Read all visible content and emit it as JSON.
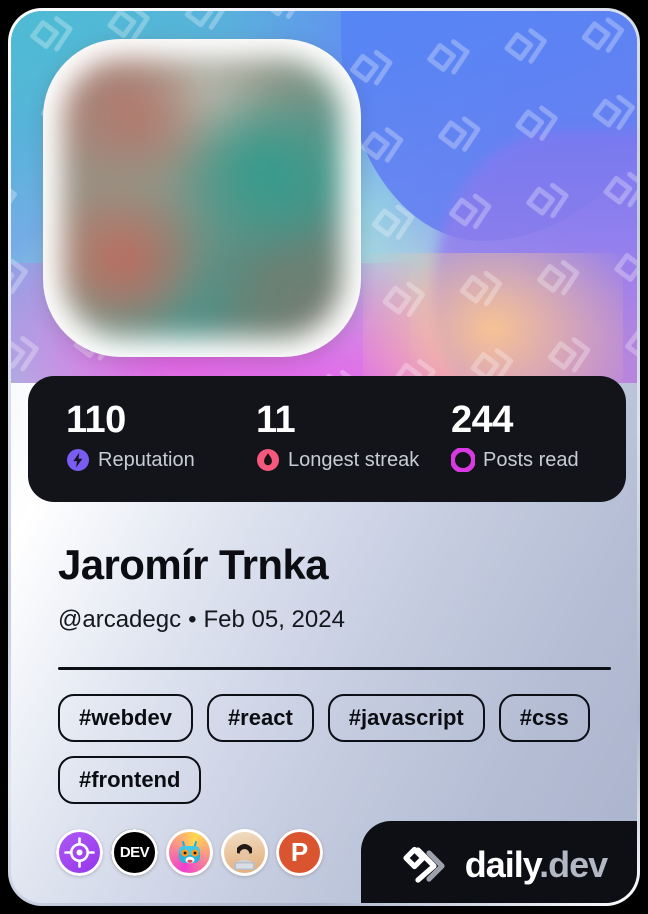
{
  "card": {
    "cover": {
      "pattern_icon": "daily-dev-chevron-watermark",
      "avatar_alt": "Profile picture"
    },
    "stats": [
      {
        "value": "110",
        "label": "Reputation",
        "icon": "reputation-bolt-icon",
        "color": "#7b5cf0"
      },
      {
        "value": "11",
        "label": "Longest streak",
        "icon": "streak-flame-icon",
        "color": "#f4597d"
      },
      {
        "value": "244",
        "label": "Posts read",
        "icon": "posts-read-ring-icon",
        "color": "#d839e0"
      }
    ],
    "profile": {
      "name": "Jaromír Trnka",
      "handle": "@arcadegc",
      "separator": "•",
      "joined_date": "Feb 05, 2024"
    },
    "tags": [
      "#webdev",
      "#react",
      "#javascript",
      "#css",
      "#frontend"
    ],
    "badges": [
      {
        "name": "target-crosshair-badge",
        "color": "#a855f7"
      },
      {
        "name": "dev-to-badge",
        "color": "#000000",
        "text": "DEV"
      },
      {
        "name": "robot-avatar-badge",
        "color": "#e63bd0"
      },
      {
        "name": "devsquad-avatar-badge",
        "color": "#e8b98a"
      },
      {
        "name": "product-hunt-badge",
        "color": "#da552f",
        "text": "P"
      }
    ],
    "footer": {
      "logo_mark": "daily-dev-logo-mark",
      "brand": "daily",
      "brand_suffix": ".dev"
    }
  }
}
